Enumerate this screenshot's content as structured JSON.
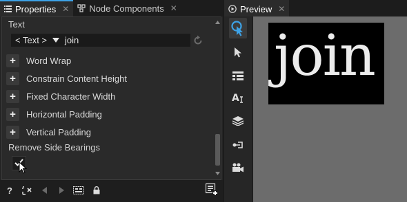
{
  "properties_panel": {
    "tabs": [
      {
        "label": "Properties",
        "icon": "list-icon",
        "active": true
      },
      {
        "label": "Node Components",
        "icon": "components-icon",
        "active": false
      }
    ],
    "text_property": {
      "label": "Text",
      "type_selector": "< Text >",
      "value": "join"
    },
    "add_properties": [
      {
        "label": "Word Wrap"
      },
      {
        "label": "Constrain Content Height"
      },
      {
        "label": "Fixed Character Width"
      },
      {
        "label": "Horizontal Padding"
      },
      {
        "label": "Vertical Padding"
      }
    ],
    "remove_side_bearings": {
      "label": "Remove Side Bearings",
      "checked": true
    },
    "bottom_toolbar": {
      "help_label": "?",
      "icons": [
        "help-icon",
        "remove-unused-icon",
        "back-icon",
        "forward-icon",
        "select-in-tree-icon",
        "lock-icon",
        "add-property-icon"
      ]
    }
  },
  "preview_panel": {
    "tab": {
      "label": "Preview",
      "icon": "play-icon"
    },
    "tools": [
      "interactive-pointer-icon",
      "selection-icon",
      "layout-icon",
      "text-icon",
      "layers-icon",
      "connector-icon",
      "camera-icon"
    ],
    "active_tool": "interactive-pointer-icon",
    "rendered_text": "join",
    "colors": {
      "accent": "#3da2e6",
      "canvas": "#6c6c6c",
      "node_background": "#000000",
      "text": "#ececec"
    }
  }
}
